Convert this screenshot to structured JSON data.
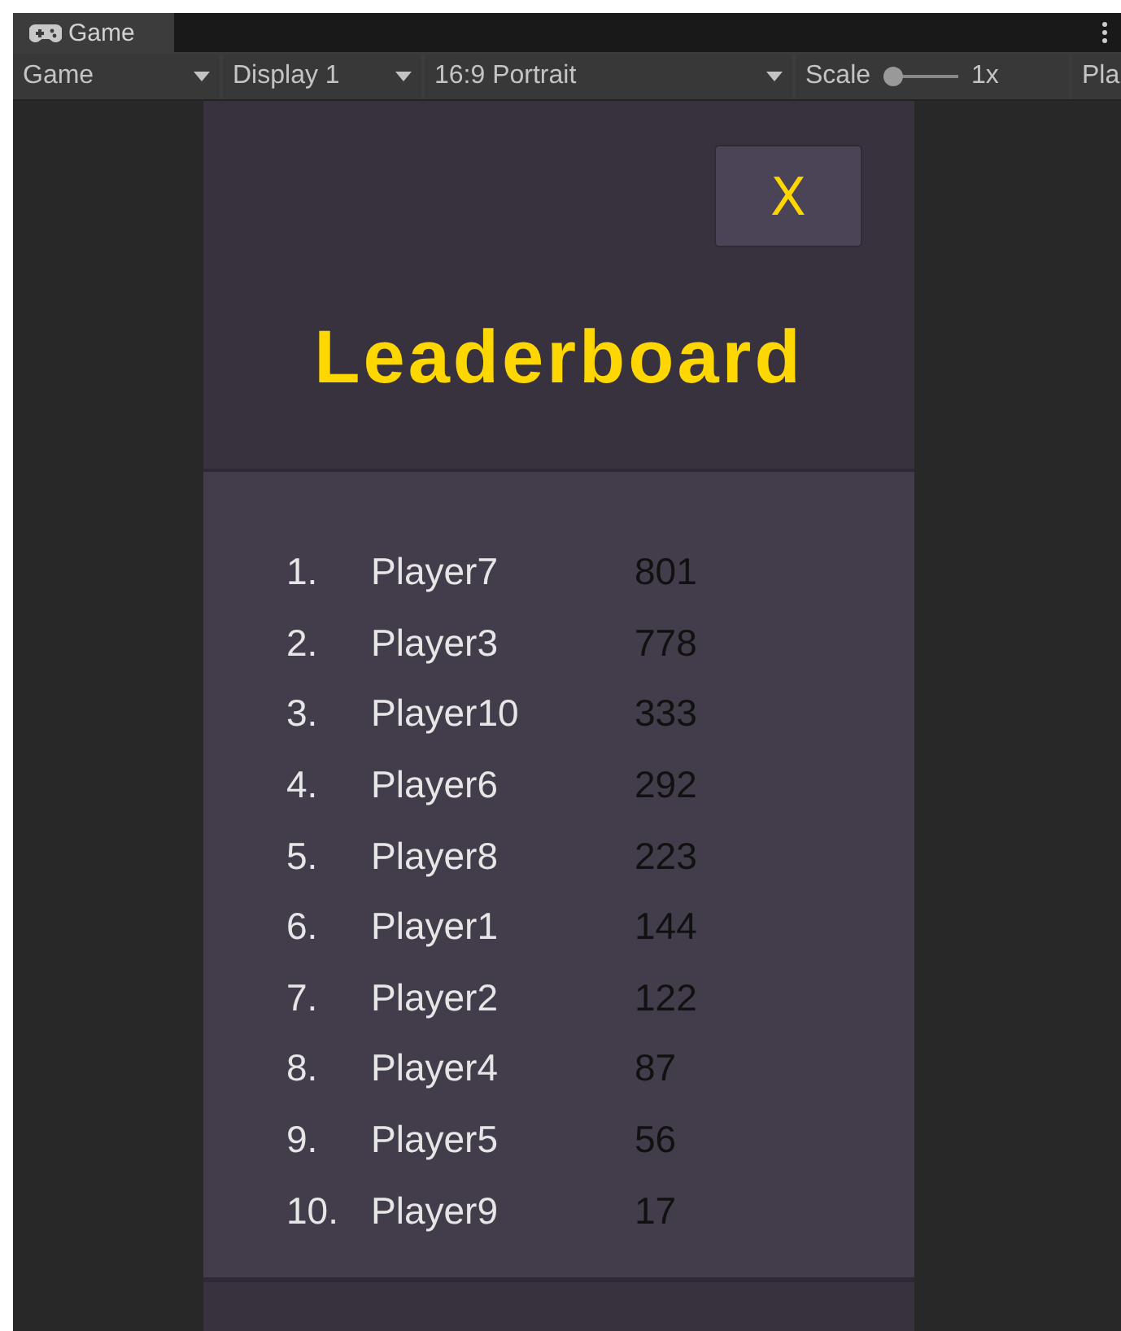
{
  "window": {
    "tab": {
      "label": "Game",
      "selected": true
    }
  },
  "toolbar": {
    "items": [
      {
        "kind": "dropdown",
        "label": "Game"
      },
      {
        "kind": "dropdown",
        "label": "Display 1"
      },
      {
        "kind": "dropdown",
        "label": "16:9 Portrait"
      },
      {
        "kind": "slider",
        "label": "Scale",
        "level": 0,
        "reading": "1x"
      },
      {
        "kind": "button",
        "label": "Pla"
      }
    ]
  },
  "panel": {
    "close_button": "X",
    "title": "Leaderboard",
    "rows": [
      {
        "rank": "1.",
        "name": "Player7",
        "score": "801"
      },
      {
        "rank": "2.",
        "name": "Player3",
        "score": "778"
      },
      {
        "rank": "3.",
        "name": "Player10",
        "score": "333"
      },
      {
        "rank": "4.",
        "name": "Player6",
        "score": "292"
      },
      {
        "rank": "5.",
        "name": "Player8",
        "score": "223"
      },
      {
        "rank": "6.",
        "name": "Player1",
        "score": "144"
      },
      {
        "rank": "7.",
        "name": "Player2",
        "score": "122"
      },
      {
        "rank": "8.",
        "name": "Player4",
        "score": "87"
      },
      {
        "rank": "9.",
        "name": "Player5",
        "score": "56"
      },
      {
        "rank": "10.",
        "name": "Player9",
        "score": "17"
      }
    ]
  }
}
